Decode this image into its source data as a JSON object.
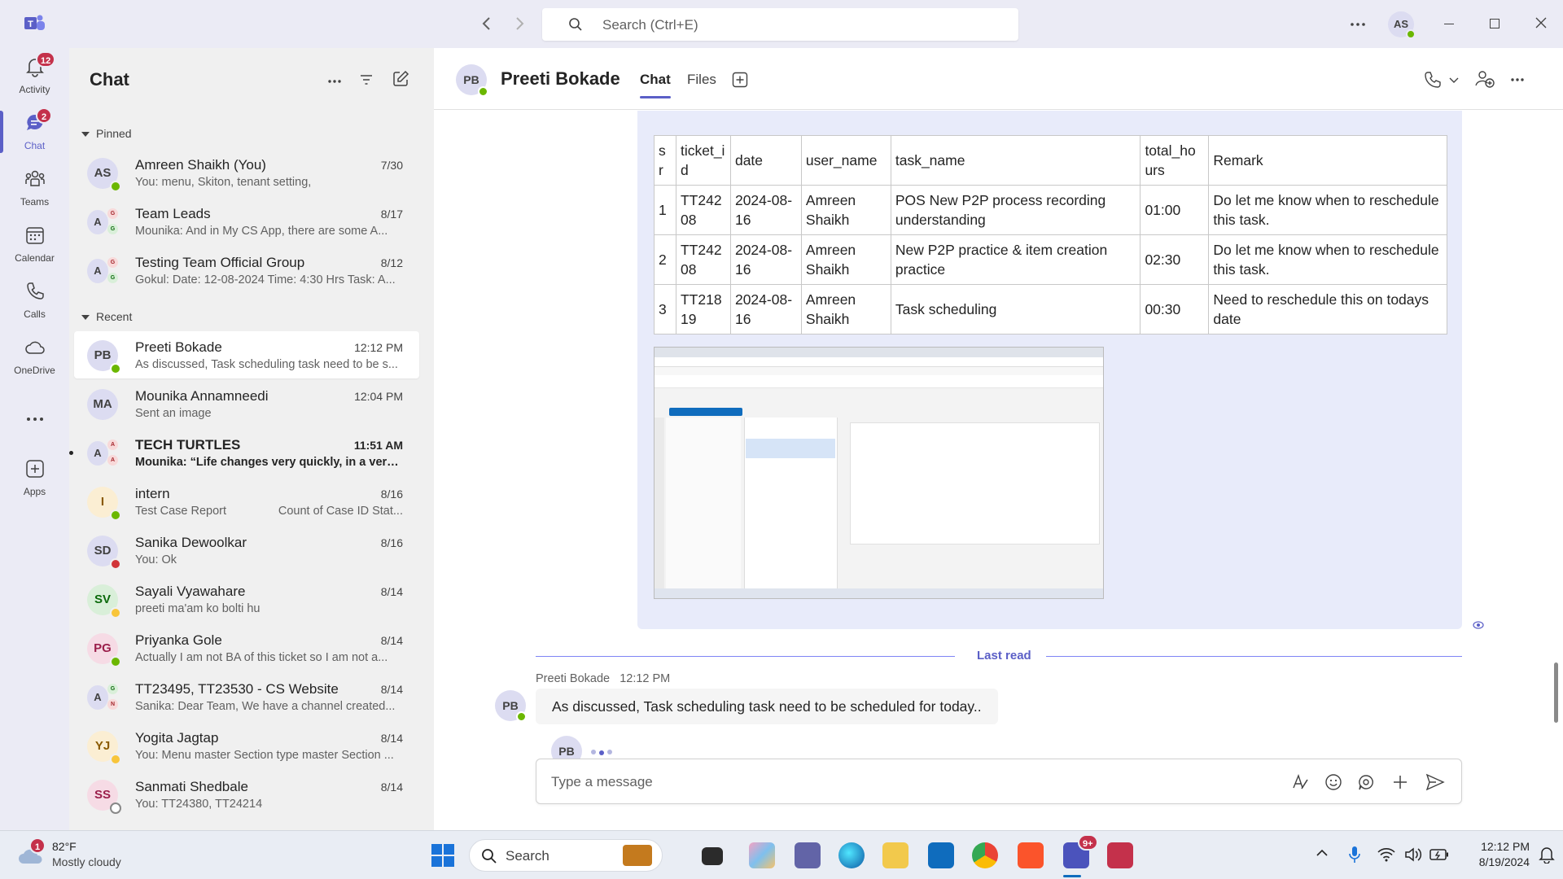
{
  "titlebar": {
    "search_placeholder": "Search (Ctrl+E)",
    "user_initials": "AS"
  },
  "rail": {
    "items": [
      {
        "label": "Activity",
        "badge": "12"
      },
      {
        "label": "Chat",
        "badge": "2"
      },
      {
        "label": "Teams"
      },
      {
        "label": "Calendar"
      },
      {
        "label": "Calls"
      },
      {
        "label": "OneDrive"
      },
      {
        "label": "Apps"
      }
    ]
  },
  "chatlist": {
    "title": "Chat",
    "pinned_label": "Pinned",
    "recent_label": "Recent",
    "pinned": [
      {
        "initials": "AS",
        "name": "Amreen Shaikh (You)",
        "time": "7/30",
        "preview": "You: menu, Skiton, tenant setting,",
        "status": "available"
      },
      {
        "initials": "A",
        "name": "Team Leads",
        "time": "8/17",
        "preview": "Mounika: And in My CS App, there are some A...",
        "group": [
          "G",
          "G"
        ]
      },
      {
        "initials": "A",
        "name": "Testing Team Official Group",
        "time": "8/12",
        "preview": "Gokul: Date: 12-08-2024 Time: 4:30 Hrs Task: A...",
        "group": [
          "G",
          "G"
        ]
      }
    ],
    "recent": [
      {
        "initials": "PB",
        "name": "Preeti Bokade",
        "time": "12:12 PM",
        "preview": "As discussed, Task scheduling task need to be s...",
        "status": "available",
        "selected": true
      },
      {
        "initials": "MA",
        "name": "Mounika Annamneedi",
        "time": "12:04 PM",
        "preview": "Sent an image"
      },
      {
        "initials": "A",
        "name": "TECH TURTLES",
        "time": "11:51 AM",
        "preview": "Mounika: “Life changes very quickly, in a very ...",
        "group": [
          "A",
          "A"
        ],
        "unread": true
      },
      {
        "initials": "I",
        "name": "intern",
        "time": "8/16",
        "preview": "Test Case Report",
        "preview2": "Count of Case ID Stat...",
        "status": "available"
      },
      {
        "initials": "SD",
        "name": "Sanika Dewoolkar",
        "time": "8/16",
        "preview": "You: Ok",
        "status": "busy"
      },
      {
        "initials": "SV",
        "name": "Sayali Vyawahare",
        "time": "8/14",
        "preview": "preeti ma'am ko bolti hu",
        "status": "away"
      },
      {
        "initials": "PG",
        "name": "Priyanka Gole",
        "time": "8/14",
        "preview": "Actually I am not BA of this ticket so I am not a...",
        "status": "available"
      },
      {
        "initials": "A",
        "name": "TT23495, TT23530 - CS Website",
        "time": "8/14",
        "preview": "Sanika: Dear Team,   We have a channel created...",
        "group": [
          "G",
          "N"
        ]
      },
      {
        "initials": "YJ",
        "name": "Yogita Jagtap",
        "time": "8/14",
        "preview": "You: Menu master Section type master Section ...",
        "status": "away"
      },
      {
        "initials": "SS",
        "name": "Sanmati Shedbale",
        "time": "8/14",
        "preview": "You: TT24380, TT24214",
        "status": "offline"
      }
    ]
  },
  "conversation": {
    "initials": "PB",
    "name": "Preeti Bokade",
    "tabs": [
      "Chat",
      "Files"
    ],
    "table": {
      "headers": [
        "s\nr",
        "ticket_i\nd",
        "date",
        "user_name",
        "task_name",
        "total_ho\nurs",
        "Remark"
      ],
      "rows": [
        [
          "1",
          "TT242\n08",
          "2024-08-\n16",
          "Amreen\nShaikh",
          "POS New P2P process recording\nunderstanding",
          "01:00",
          "Do let me know when to reschedule\nthis task."
        ],
        [
          "2",
          "TT242\n08",
          "2024-08-\n16",
          "Amreen\nShaikh",
          "New P2P practice & item creation\npractice",
          "02:30",
          "Do let me know when to reschedule\nthis task."
        ],
        [
          "3",
          "TT218\n19",
          "2024-08-\n16",
          "Amreen\nShaikh",
          "Task scheduling",
          "00:30",
          "Need to reschedule this on todays\ndate"
        ]
      ]
    },
    "last_read": "Last read",
    "message": {
      "sender": "Preeti Bokade",
      "time": "12:12 PM",
      "text": "As discussed, Task scheduling task need to be scheduled for today.."
    },
    "typing_initials": "PB",
    "compose_placeholder": "Type a message"
  },
  "taskbar": {
    "weather_temp": "82°F",
    "weather_desc": "Mostly cloudy",
    "weather_badge": "1",
    "search_label": "Search",
    "teams_badge": "9+",
    "clock_time": "12:12 PM",
    "clock_date": "8/19/2024"
  },
  "colors": {
    "accent": "#5b5fc7",
    "badge": "#c4314b",
    "available": "#6bb700",
    "busy": "#d13438",
    "away": "#f8c53a"
  }
}
